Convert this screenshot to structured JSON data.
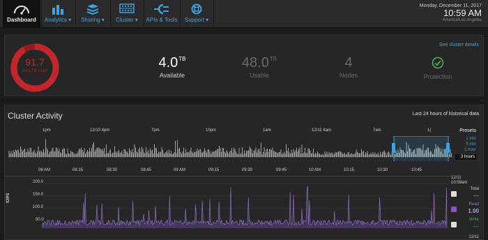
{
  "nav": {
    "items": [
      {
        "label": "Dashboard",
        "icon": "gauge-icon",
        "active": true
      },
      {
        "label": "Analytics ▾",
        "icon": "bar-chart-icon"
      },
      {
        "label": "Sharing ▾",
        "icon": "stack-icon"
      },
      {
        "label": "Cluster ▾",
        "icon": "server-icon"
      },
      {
        "label": "APIs & Tools",
        "icon": "plug-icon"
      },
      {
        "label": "Support ▾",
        "icon": "lifebuoy-icon"
      }
    ],
    "date": "Monday, December 11, 2017",
    "time": "10:59 AM",
    "timezone": "America/Los Angeles"
  },
  "summary": {
    "donut_percent": "91.7",
    "donut_percent_value": 91.7,
    "donut_sub": "44.0 TB Used",
    "available_value": "4.0",
    "available_unit": "TB",
    "available_label": "Available",
    "usable_value": "48.0",
    "usable_unit": "TB",
    "usable_label": "Usable",
    "nodes_value": "4",
    "nodes_label": "Nodes",
    "protection_label": "Protection",
    "cluster_link": "See cluster details",
    "colors": {
      "danger": "#c0262b",
      "accent": "#3ea2df",
      "ok": "#4caf50",
      "read": "#7e57c2"
    }
  },
  "activity": {
    "title": "Cluster Activity",
    "history_note": "Last 24 hours of historical data",
    "top_ticks": [
      "1pm",
      "12/10 4pm",
      "7pm",
      "10pm",
      "1am",
      "12/11 4am",
      "7am",
      "1("
    ],
    "bottom_ticks": [
      "08 AM",
      "08:15",
      "08:30",
      "08:45",
      "09 AM",
      "09:15",
      "09:30",
      "09:45",
      "10 AM",
      "10:15",
      "10:30",
      "10:45"
    ],
    "presets_label": "Presets",
    "presets": [
      "1 min",
      "5 min",
      "1 hour"
    ],
    "preset_active": "3 hours",
    "iops_label": "IOPS",
    "y_ticks": [
      "200.0",
      "150.0",
      "100.0",
      "50.0"
    ],
    "legend_date": "12/11",
    "legend_time": "10:59am",
    "legend": [
      {
        "name": "Total",
        "value": "---",
        "checked": false
      },
      {
        "name": "Read",
        "value": "1.00",
        "checked": true
      },
      {
        "name": "Write",
        "value": "---",
        "checked": false
      }
    ],
    "bottom_date": "12/11"
  }
}
